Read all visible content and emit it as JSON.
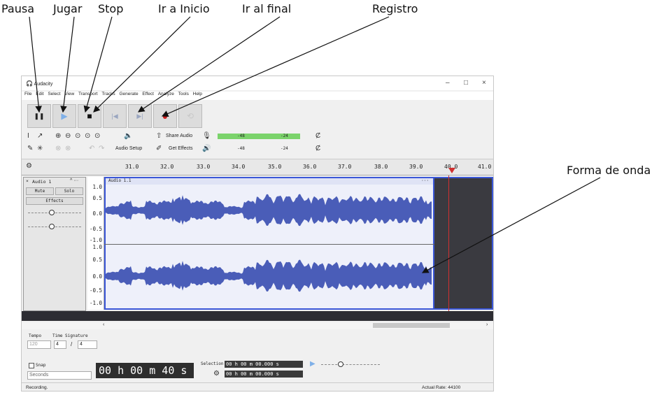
{
  "annotations": {
    "pausa": "Pausa",
    "jugar": "Jugar",
    "stop": "Stop",
    "inicio": "Ir a Inicio",
    "final": "Ir al final",
    "registro": "Registro",
    "onda": "Forma de onda"
  },
  "window": {
    "app_name": "Audacity",
    "minimize": "–",
    "maximize": "□",
    "close": "×"
  },
  "menu": [
    "File",
    "Edit",
    "Select",
    "View",
    "Transport",
    "Tracks",
    "Generate",
    "Effect",
    "Analyze",
    "Tools",
    "Help"
  ],
  "transport": {
    "pause": "❚❚",
    "play": "▶",
    "stop": "■",
    "skip_start": "|◀",
    "skip_end": "▶|",
    "record": "●",
    "loop": "⟲"
  },
  "toolbar": {
    "audio_setup": "Audio Setup",
    "share_audio": "Share Audio",
    "get_effects": "Get Effects",
    "meter_ticks_top": [
      "-48",
      "-24"
    ],
    "meter_ticks_bottom": [
      "-48",
      "-24"
    ]
  },
  "ruler_ticks": [
    "31.0",
    "32.0",
    "33.0",
    "34.0",
    "35.0",
    "36.0",
    "37.0",
    "38.0",
    "39.0",
    "40.0",
    "41.0"
  ],
  "track": {
    "name": "Audio 1",
    "clip_name": "Audio 1.1",
    "mute": "Mute",
    "solo": "Solo",
    "effects": "Effects",
    "scale": [
      "1.0",
      "0.5",
      "0.0",
      "-0.5",
      "-1.0",
      "1.0",
      "0.5",
      "0.0",
      "-0.5",
      "-1.0"
    ]
  },
  "bottom": {
    "tempo_label": "Tempo",
    "tempo_value": "120",
    "time_sig_label": "Time Signature",
    "time_sig_num": "4",
    "time_sig_sep": "/",
    "time_sig_den": "4",
    "snap_label": "Snap",
    "snap_unit": "Seconds",
    "time_display": "00 h 00 m 40 s",
    "selection_label": "Selection",
    "selection_start": "00 h 00 m 00.000 s",
    "selection_end": "00 h 00 m 00.000 s"
  },
  "status": {
    "left": "Recording.",
    "right": "Actual Rate: 44100"
  }
}
